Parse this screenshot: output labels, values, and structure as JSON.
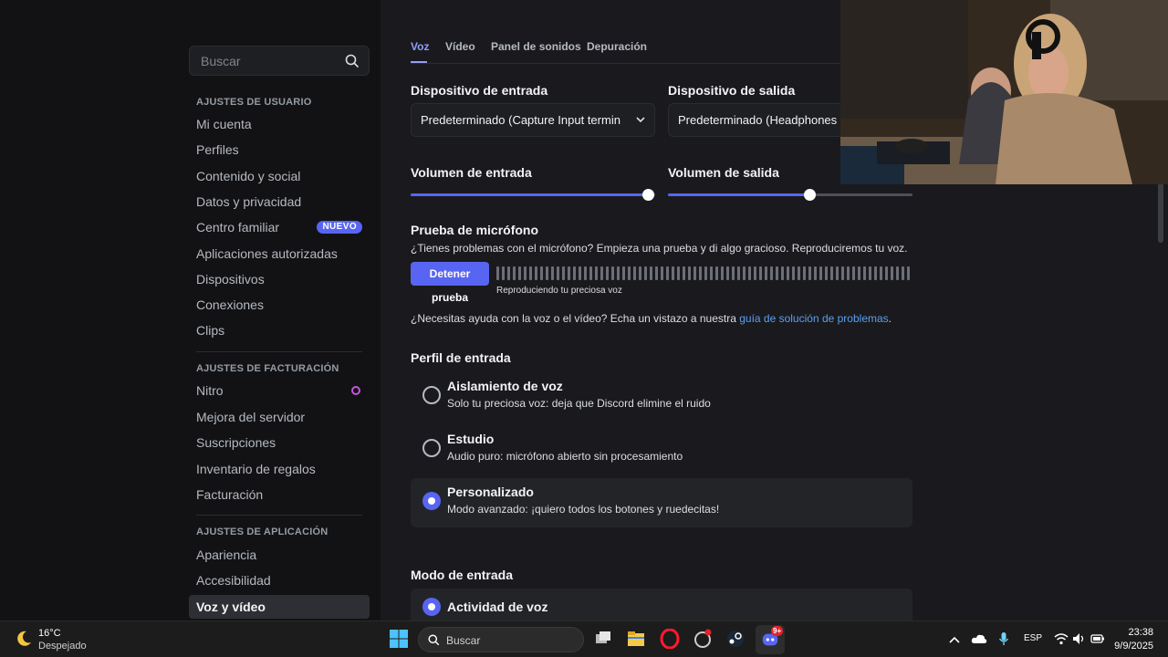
{
  "sidebar": {
    "search_placeholder": "Buscar",
    "sections": [
      {
        "heading": "AJUSTES DE USUARIO",
        "items": [
          "Mi cuenta",
          "Perfiles",
          "Contenido y social",
          "Datos y privacidad",
          "Centro familiar",
          "Aplicaciones autorizadas",
          "Dispositivos",
          "Conexiones",
          "Clips"
        ]
      },
      {
        "heading": "AJUSTES DE FACTURACIÓN",
        "items": [
          "Nitro",
          "Mejora del servidor",
          "Suscripciones",
          "Inventario de regalos",
          "Facturación"
        ]
      },
      {
        "heading": "AJUSTES DE APLICACIÓN",
        "items": [
          "Apariencia",
          "Accesibilidad",
          "Voz y vídeo"
        ]
      }
    ],
    "new_badge": "NUEVO"
  },
  "tabs": [
    "Voz",
    "Vídeo",
    "Panel de sonidos",
    "Depuración"
  ],
  "input_device": {
    "label": "Dispositivo de entrada",
    "value": "Predeterminado (Capture Input termin"
  },
  "output_device": {
    "label": "Dispositivo de salida",
    "value": "Predeterminado (Headphones ("
  },
  "input_volume": {
    "label": "Volumen de entrada",
    "level_fraction": 0.97
  },
  "output_volume": {
    "label": "Volumen de salida",
    "level_fraction": 0.58
  },
  "mic_test": {
    "title": "Prueba de micrófono",
    "description": "¿Tienes problemas con el micrófono? Empieza una prueba y di algo gracioso. Reproduciremos tu voz.",
    "button": "Detener prueba",
    "status": "Reproduciendo tu preciosa voz"
  },
  "help": {
    "text": "¿Necesitas ayuda con la voz o el vídeo? Echa un vistazo a nuestra ",
    "link": "guía de solución de problemas",
    "end": "."
  },
  "input_profile": {
    "title": "Perfil de entrada",
    "options": [
      {
        "title": "Aislamiento de voz",
        "sub": "Solo tu preciosa voz: deja que Discord elimine el ruido"
      },
      {
        "title": "Estudio",
        "sub": "Audio puro: micrófono abierto sin procesamiento"
      },
      {
        "title": "Personalizado",
        "sub": "Modo avanzado: ¡quiero todos los botones y ruedecitas!"
      }
    ]
  },
  "input_mode": {
    "title": "Modo de entrada",
    "option": "Actividad de voz"
  },
  "taskbar": {
    "temperature": "16°C",
    "weather": "Despejado",
    "search": "Buscar",
    "lang": "ESP",
    "time": "23:38",
    "date": "9/9/2025",
    "discord_badge": "9+"
  },
  "colors": {
    "accent": "#5865f2",
    "link": "#5b9ef0",
    "badge": "#5865f2"
  }
}
